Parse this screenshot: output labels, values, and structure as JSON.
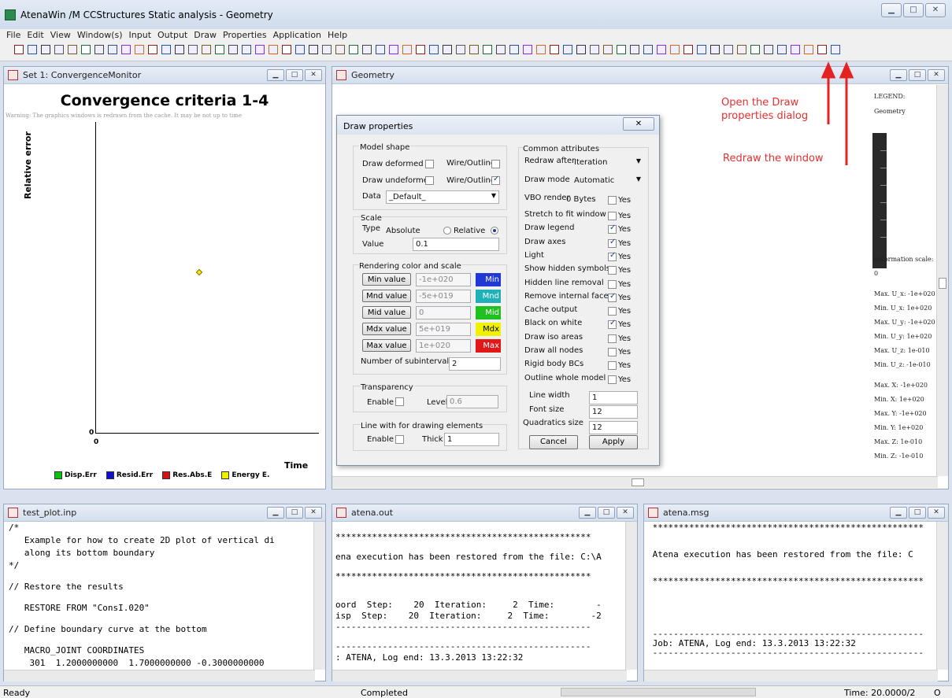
{
  "window": {
    "title": "AtenaWin /M CCStructures  Static analysis - Geometry"
  },
  "menu": [
    "File",
    "Edit",
    "View",
    "Window(s)",
    "Input",
    "Output",
    "Draw",
    "Properties",
    "Application",
    "Help"
  ],
  "convergence": {
    "caption": "Set 1: ConvergenceMonitor",
    "title": "Convergence criteria 1-4",
    "warning": "Warning: The graphics windows is redrawn from the cache. It may be not up to time",
    "ylabel": "Relative error",
    "xlabel": "Time",
    "y0": "0",
    "x0": "0",
    "legend": [
      {
        "label": "Disp.Err",
        "color": "#10c010"
      },
      {
        "label": "Resid.Err",
        "color": "#1010c8"
      },
      {
        "label": "Res.Abs.E",
        "color": "#d81010"
      },
      {
        "label": "Energy E.",
        "color": "#f0f000"
      }
    ]
  },
  "geometry": {
    "caption": "Geometry",
    "legend_title": "LEGEND:",
    "legend_sub": "Geometry",
    "deformation_label": "deformation scale:",
    "deformation_value": "0",
    "stats1": [
      "Max. U_x:  -1e+020",
      "Min. U_x:  1e+020",
      "Max. U_y:  -1e+020",
      "Min. U_y:  1e+020",
      "Max. U_z:  1e-010",
      "Min. U_z:  -1e-010"
    ],
    "stats2": [
      "Max. X:  -1e+020",
      "Min. X:  1e+020",
      "Max. Y:  -1e+020",
      "Min. Y:  1e+020",
      "Max. Z:  1e-010",
      "Min. Z:  -1e-010"
    ]
  },
  "annotations": {
    "open_draw": "Open the Draw properties dialog",
    "redraw": "Redraw the window"
  },
  "dialog": {
    "title": "Draw properties",
    "model_shape": "Model shape",
    "draw_deformed": "Draw deformed",
    "draw_undeformed": "Draw undeformed",
    "wire_outline": "Wire/Outline",
    "data_label": "Data",
    "data_value": "_Default_",
    "scale": "Scale",
    "type_label": "Type",
    "absolute": "Absolute",
    "relative": "Relative",
    "value_label": "Value",
    "value": "0.1",
    "rendering": "Rendering color and scale",
    "colors": [
      {
        "btn": "Min value",
        "val": "-1e+020",
        "tag": "Min",
        "color": "#2038d8"
      },
      {
        "btn": "Mnd value",
        "val": "-5e+019",
        "tag": "Mnd",
        "color": "#20b0b8"
      },
      {
        "btn": "Mid value",
        "val": "0",
        "tag": "Mid",
        "color": "#20c020"
      },
      {
        "btn": "Mdx value",
        "val": "5e+019",
        "tag": "Mdx",
        "color": "#f0f000"
      },
      {
        "btn": "Max value",
        "val": "1e+020",
        "tag": "Max",
        "color": "#e01818"
      }
    ],
    "subintervals_label": "Number of subintervals",
    "subintervals": "2",
    "transparency": "Transparency",
    "enable": "Enable",
    "level_label": "Level",
    "level": "0.6",
    "line_with": "Line with for drawing elements",
    "thick_label": "Thick",
    "thick": "1",
    "common": "Common attributes",
    "redraw_after": "Redraw after",
    "redraw_after_value": "Iteration",
    "draw_mode": "Draw mode",
    "draw_mode_value": "Automatic",
    "vbo_render": "VBO render",
    "vbo_bytes": "0 Bytes",
    "yes": "Yes",
    "attrs": [
      "Stretch to fit window",
      "Draw legend",
      "Draw axes",
      "Light",
      "Show hidden symbols",
      "Hidden line removal",
      "Remove internal faces",
      "Cache output",
      "Black on white",
      "Draw iso areas",
      "Draw all nodes",
      "Rigid body BCs",
      "Outline whole model"
    ],
    "line_width_label": "Line width",
    "line_width": "1",
    "font_size_label": "Font size",
    "font_size": "12",
    "quad_label": "Quadratics size",
    "quad": "12",
    "cancel": "Cancel",
    "apply": "Apply"
  },
  "test_plot": {
    "caption": "test_plot.inp",
    "lines": [
      "/*",
      "   Example for how to create 2D plot of vertical di",
      "   along its bottom boundary",
      "*/",
      "",
      "// Restore the results",
      "",
      "   RESTORE FROM \"ConsI.020\"",
      "",
      "// Define boundary curve at the bottom",
      "",
      "   MACRO_JOINT COORDINATES",
      "    301  1.2000000000  1.7000000000 -0.3000000000"
    ]
  },
  "atena_out": {
    "caption": "atena.out",
    "lines": [
      "",
      "*************************************************",
      "",
      "ena execution has been restored from the file: C:\\A",
      "",
      "*************************************************",
      "",
      "",
      "oord  Step:    20  Iteration:     2  Time:        -",
      "isp  Step:    20  Iteration:     2  Time:        -2",
      "-------------------------------------------------",
      "",
      "-------------------------------------------------",
      ": ATENA, Log end: 13.3.2013 13:22:32",
      "-------------------------------------------------"
    ]
  },
  "atena_msg": {
    "caption": "atena.msg",
    "lines": [
      " ****************************************************",
      "",
      "",
      " Atena execution has been restored from the file: C",
      "",
      "",
      " ****************************************************",
      "",
      "",
      "",
      "",
      "",
      " ----------------------------------------------------",
      " Job: ATENA, Log end: 13.3.2013 13:22:32",
      " ----------------------------------------------------"
    ]
  },
  "status": {
    "left": "Ready",
    "middle": "Completed",
    "time": "Time: 20.0000/2",
    "mode": "O"
  }
}
